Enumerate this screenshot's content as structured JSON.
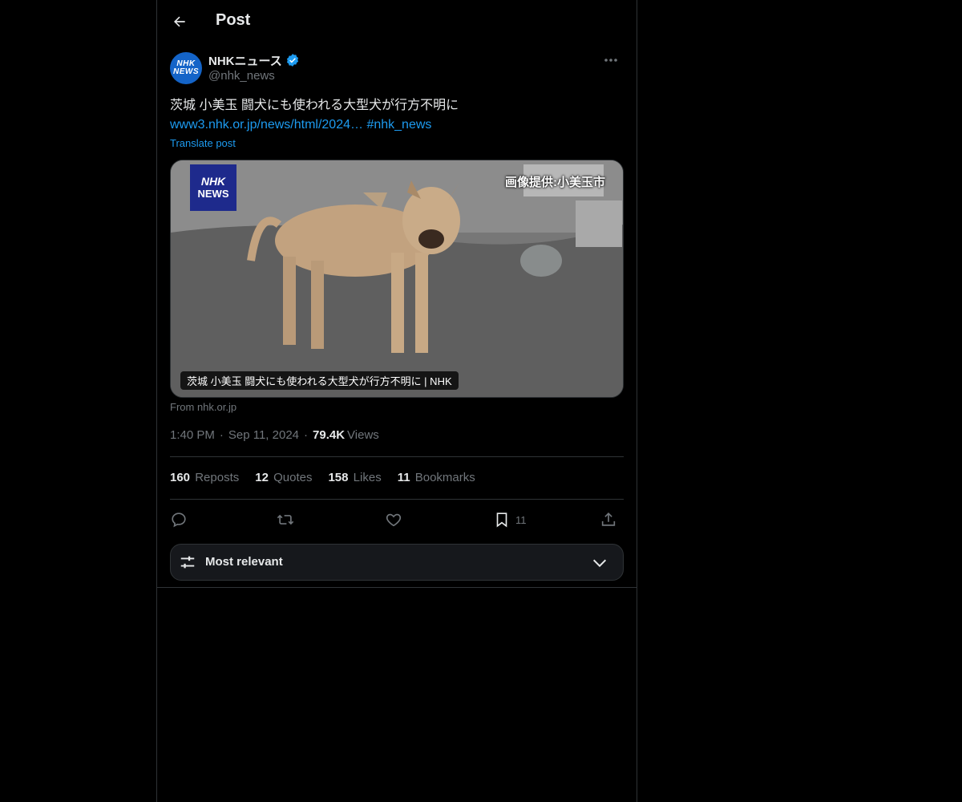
{
  "header": {
    "title": "Post"
  },
  "author": {
    "avatar_top": "NHK",
    "avatar_bottom": "NEWS",
    "display_name": "NHKニュース",
    "handle": "@nhk_news"
  },
  "post": {
    "text": "茨城 小美玉 闘犬にも使われる大型犬が行方不明に",
    "link": "www3.nhk.or.jp/news/html/2024…",
    "hashtag": "#nhk_news",
    "translate_label": "Translate post"
  },
  "media": {
    "logo_top": "NHK",
    "logo_bottom": "NEWS",
    "credit": "画像提供:小美玉市",
    "caption": "茨城 小美玉 闘犬にも使われる大型犬が行方不明に | NHK",
    "source": "From nhk.or.jp"
  },
  "meta": {
    "time": "1:40 PM",
    "date": "Sep 11, 2024",
    "views_count": "79.4K",
    "views_label": "Views"
  },
  "stats": {
    "reposts_count": "160",
    "reposts_label": "Reposts",
    "quotes_count": "12",
    "quotes_label": "Quotes",
    "likes_count": "158",
    "likes_label": "Likes",
    "bookmarks_count": "11",
    "bookmarks_label": "Bookmarks"
  },
  "actions": {
    "icons": [
      "reply-icon",
      "repost-icon",
      "like-icon",
      "bookmark-icon",
      "share-icon"
    ],
    "bookmark_count": "11"
  },
  "sort": {
    "label": "Most relevant"
  },
  "colors": {
    "accent": "#1d9bf0",
    "background": "#000000",
    "muted": "#71767b",
    "text": "#e7e9ea"
  }
}
